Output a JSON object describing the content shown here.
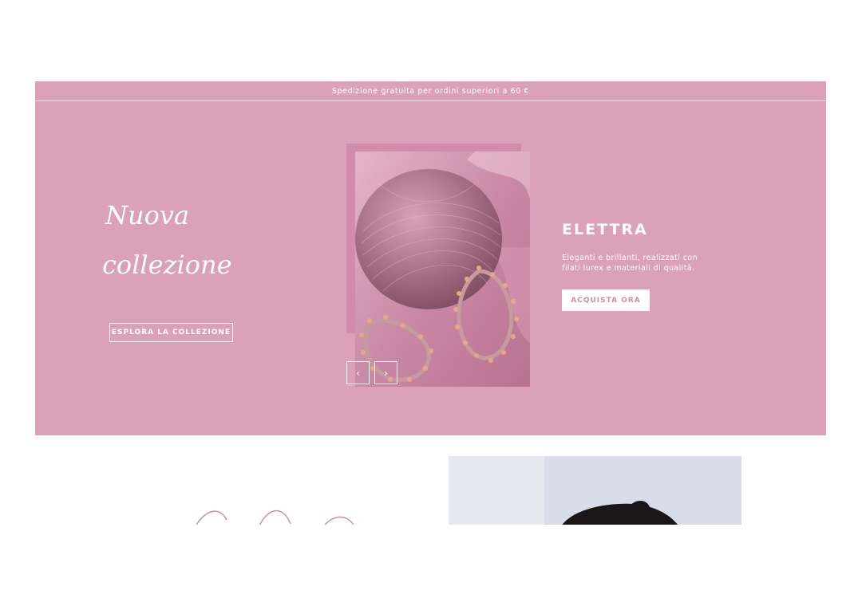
{
  "announcement": {
    "text": "Spedizione gratuita per ordini superiori a 60 €"
  },
  "hero": {
    "script_title": [
      "Nuova",
      "collezione"
    ],
    "explore_button": "ESPLORA LA COLLEZIONE",
    "product": {
      "name": "ELETTRA",
      "description": "Eleganti e brillanti, realizzati con filati lurex e materiali di qualità.",
      "cta": "ACQUISTA ORA"
    },
    "carousel": {
      "prev_icon": "chevron-left-icon",
      "next_icon": "chevron-right-icon"
    }
  },
  "colors": {
    "hero_background": "#dba1b9",
    "image_frame": "#cf8daa",
    "cta_text": "#d48aa8",
    "white": "#ffffff"
  }
}
